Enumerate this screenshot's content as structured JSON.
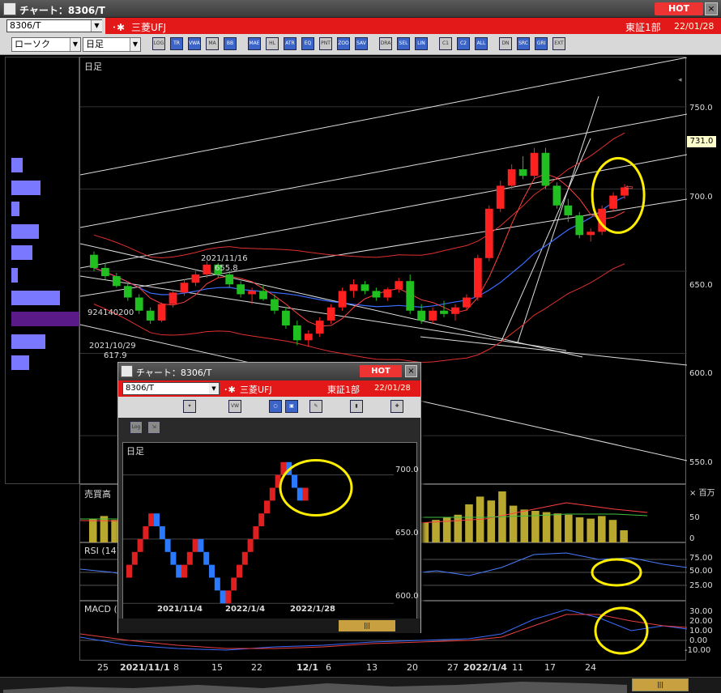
{
  "window": {
    "title": "チャート：8306/T",
    "hot_label": "HOT",
    "close": "×"
  },
  "symbol": {
    "code": "8306/T",
    "name": "三菱UFJ",
    "market": "東証1部",
    "date": "22/01/28"
  },
  "controls": {
    "chart_type": "ローソク",
    "period": "日足"
  },
  "toolbar": [
    "LOG",
    "TR",
    "VWAP",
    "MA",
    "BB",
    "MAE",
    "HL",
    "ATR",
    "EQ",
    "PNT",
    "ZOOM",
    "SAVE",
    "DRAW",
    "SEL",
    "LINE",
    "C1",
    "C2",
    "ALL",
    "DN",
    "SRCH",
    "GRID",
    "EXT"
  ],
  "chart": {
    "period_label": "日足",
    "price_axis": [
      "750.0",
      "700.0",
      "650.0",
      "600.0",
      "550.0"
    ],
    "current_price": "731.0",
    "annotations": {
      "high_date": "2021/11/16",
      "high_value": "655.8",
      "volume_at": "924140200",
      "low_date": "2021/10/29",
      "low_value": "617.9"
    },
    "candles_ohlc": [
      [
        660,
        662,
        650,
        652
      ],
      [
        652,
        655,
        645,
        647
      ],
      [
        647,
        649,
        640,
        641
      ],
      [
        641,
        643,
        632,
        634
      ],
      [
        634,
        636,
        624,
        626
      ],
      [
        626,
        628,
        618,
        620
      ],
      [
        620,
        631,
        619,
        630
      ],
      [
        630,
        639,
        628,
        637
      ],
      [
        637,
        645,
        635,
        643
      ],
      [
        643,
        650,
        641,
        648
      ],
      [
        648,
        656,
        646,
        654
      ],
      [
        654,
        655,
        646,
        648
      ],
      [
        648,
        650,
        640,
        642
      ],
      [
        642,
        644,
        634,
        636
      ],
      [
        636,
        640,
        630,
        638
      ],
      [
        638,
        642,
        632,
        633
      ],
      [
        633,
        636,
        624,
        626
      ],
      [
        626,
        628,
        615,
        617
      ],
      [
        617,
        620,
        605,
        608
      ],
      [
        608,
        614,
        604,
        612
      ],
      [
        612,
        622,
        610,
        620
      ],
      [
        620,
        630,
        618,
        628
      ],
      [
        628,
        640,
        626,
        638
      ],
      [
        638,
        645,
        634,
        642
      ],
      [
        642,
        644,
        636,
        638
      ],
      [
        638,
        640,
        632,
        634
      ],
      [
        634,
        640,
        632,
        639
      ],
      [
        639,
        646,
        637,
        644
      ],
      [
        644,
        648,
        624,
        626
      ],
      [
        626,
        630,
        618,
        620
      ],
      [
        620,
        628,
        618,
        626
      ],
      [
        626,
        632,
        622,
        624
      ],
      [
        624,
        630,
        620,
        628
      ],
      [
        628,
        636,
        626,
        634
      ],
      [
        634,
        660,
        632,
        658
      ],
      [
        658,
        690,
        656,
        688
      ],
      [
        688,
        705,
        686,
        702
      ],
      [
        702,
        715,
        700,
        712
      ],
      [
        712,
        720,
        706,
        708
      ],
      [
        708,
        725,
        706,
        722
      ],
      [
        722,
        725,
        700,
        702
      ],
      [
        702,
        704,
        688,
        690
      ],
      [
        690,
        694,
        680,
        684
      ],
      [
        684,
        686,
        670,
        672
      ],
      [
        672,
        676,
        668,
        674
      ],
      [
        674,
        690,
        672,
        688
      ],
      [
        688,
        698,
        686,
        696
      ],
      [
        696,
        703,
        694,
        701
      ]
    ]
  },
  "volume_panel": {
    "label": "売買高",
    "unit": "百万",
    "axis": [
      "50",
      "0"
    ],
    "values": [
      38,
      42,
      36,
      40,
      34,
      30,
      44,
      48,
      38,
      34,
      52,
      46,
      40,
      36,
      34,
      40,
      44,
      38,
      32,
      28,
      34,
      40,
      46,
      42,
      38,
      36,
      40,
      44,
      30,
      34,
      32,
      36,
      40,
      44,
      60,
      72,
      66,
      80,
      58,
      52,
      50,
      48,
      46,
      44,
      40,
      38,
      42,
      36,
      20
    ]
  },
  "rsi_panel": {
    "label": "RSI (14)",
    "axis": [
      "75.00",
      "50.00",
      "25.00"
    ]
  },
  "macd_panel": {
    "label": "MACD (",
    "axis": [
      "30.00",
      "20.00",
      "10.00",
      "0.00",
      "-10.00"
    ]
  },
  "x_axis": [
    "25",
    "2021/11/1",
    "8",
    "15",
    "22",
    "12/1",
    "6",
    "13",
    "20",
    "27",
    "2022/1/4",
    "11",
    "17",
    "24"
  ],
  "popup": {
    "title": "チャート：8306/T",
    "hot_label": "HOT",
    "close": "×",
    "symbol": "8306/T",
    "name": "三菱UFJ",
    "market": "東証1部",
    "date": "22/01/28",
    "period_label": "日足",
    "axis": [
      "700.0",
      "650.0",
      "600.0"
    ],
    "x_axis": [
      "2021/11/4",
      "2022/1/4",
      "2022/1/28"
    ],
    "bricks": [
      {
        "dir": "up",
        "v": 630
      },
      {
        "dir": "up",
        "v": 640
      },
      {
        "dir": "up",
        "v": 650
      },
      {
        "dir": "up",
        "v": 660
      },
      {
        "dir": "up",
        "v": 670
      },
      {
        "dir": "dn",
        "v": 660
      },
      {
        "dir": "dn",
        "v": 650
      },
      {
        "dir": "dn",
        "v": 640
      },
      {
        "dir": "dn",
        "v": 630
      },
      {
        "dir": "dn",
        "v": 620
      },
      {
        "dir": "up",
        "v": 630
      },
      {
        "dir": "up",
        "v": 640
      },
      {
        "dir": "up",
        "v": 650
      },
      {
        "dir": "dn",
        "v": 640
      },
      {
        "dir": "dn",
        "v": 630
      },
      {
        "dir": "dn",
        "v": 620
      },
      {
        "dir": "dn",
        "v": 610
      },
      {
        "dir": "dn",
        "v": 600
      },
      {
        "dir": "up",
        "v": 610
      },
      {
        "dir": "up",
        "v": 620
      },
      {
        "dir": "up",
        "v": 630
      },
      {
        "dir": "up",
        "v": 640
      },
      {
        "dir": "up",
        "v": 650
      },
      {
        "dir": "up",
        "v": 660
      },
      {
        "dir": "up",
        "v": 670
      },
      {
        "dir": "up",
        "v": 680
      },
      {
        "dir": "up",
        "v": 690
      },
      {
        "dir": "up",
        "v": 700
      },
      {
        "dir": "up",
        "v": 710
      },
      {
        "dir": "dn",
        "v": 700
      },
      {
        "dir": "dn",
        "v": 690
      },
      {
        "dir": "dn",
        "v": 680
      },
      {
        "dir": "up",
        "v": 690
      }
    ]
  }
}
